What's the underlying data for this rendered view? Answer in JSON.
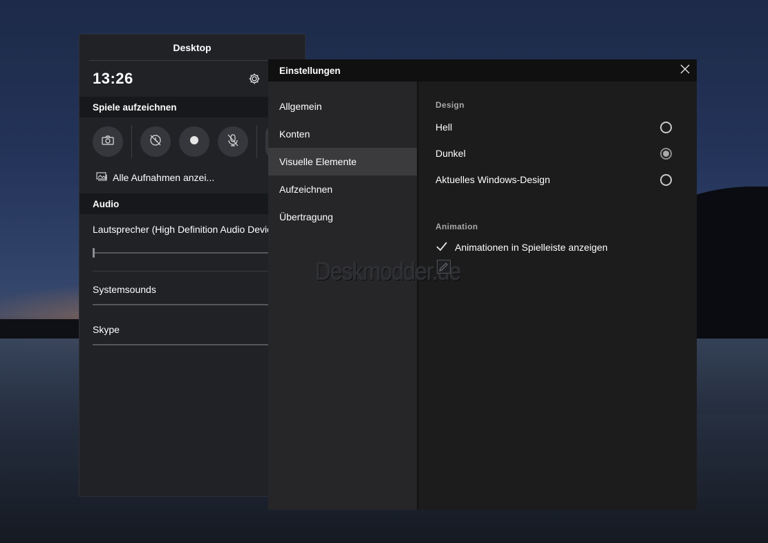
{
  "gamebar": {
    "title": "Desktop",
    "clock": "13:26",
    "capture_section": "Spiele aufzeichnen",
    "all_captures_label": "Alle Aufnahmen anzei...",
    "audio_section": "Audio",
    "audio_device": "Lautsprecher (High Definition Audio Devic",
    "apps": [
      {
        "label": "Systemsounds",
        "volume": 1.0
      },
      {
        "label": "Skype",
        "volume": 1.0
      }
    ],
    "master_volume": 0.0
  },
  "settings": {
    "title": "Einstellungen",
    "nav": [
      {
        "label": "Allgemein",
        "active": false
      },
      {
        "label": "Konten",
        "active": false
      },
      {
        "label": "Visuelle Elemente",
        "active": true
      },
      {
        "label": "Aufzeichnen",
        "active": false
      },
      {
        "label": "Übertragung",
        "active": false
      }
    ],
    "design_label": "Design",
    "design_options": [
      {
        "label": "Hell",
        "checked": false
      },
      {
        "label": "Dunkel",
        "checked": true
      },
      {
        "label": "Aktuelles Windows-Design",
        "checked": false
      }
    ],
    "animation_label": "Animation",
    "animation_checkbox": {
      "label": "Animationen in Spielleiste anzeigen",
      "checked": true
    }
  },
  "watermark": "Deskmodder.de",
  "colors": {
    "panel": "#202226",
    "settings_bg": "#1c1c1d",
    "nav_bg": "#262628",
    "nav_active": "#3b3b3d"
  }
}
